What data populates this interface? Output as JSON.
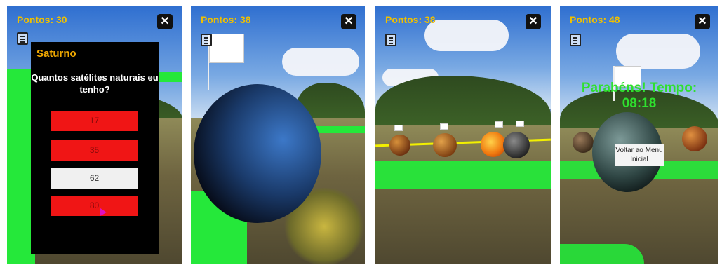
{
  "screens": [
    {
      "points": "Pontos: 30",
      "close_label": "✕",
      "quiz": {
        "planet": "Saturno",
        "question": "Quantos satélites naturais eu tenho?",
        "answers": [
          "17",
          "35",
          "62",
          "80"
        ]
      }
    },
    {
      "points": "Pontos: 38",
      "close_label": "✕"
    },
    {
      "points": "Pontos: 38",
      "close_label": "✕"
    },
    {
      "points": "Pontos: 48",
      "close_label": "✕",
      "congrats_line1": "Parabéns! Tempo:",
      "congrats_line2": "08:18",
      "back_button": "Voltar ao Menu Inicial"
    }
  ],
  "icons": {
    "close": "close-icon",
    "menu": "list-menu-icon"
  },
  "colors": {
    "points": "#f0c000",
    "answer_wrong": "#f01515",
    "answer_selected": "#f0f0f0",
    "congrats": "#2ee02e",
    "ar_plane": "#25e83a"
  }
}
